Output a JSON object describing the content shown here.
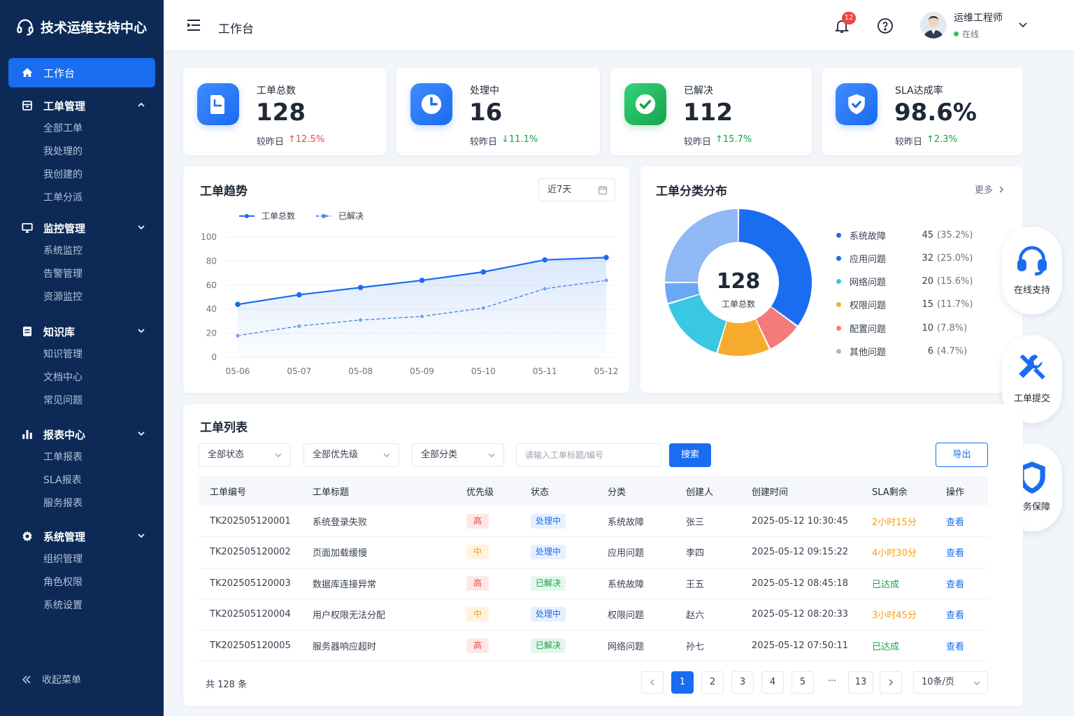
{
  "sidebar": {
    "brand": "技术运维支持中心",
    "home": "工作台",
    "groups": [
      {
        "label": "工单管理",
        "items": [
          "全部工单",
          "我处理的",
          "我创建的",
          "工单分派"
        ]
      },
      {
        "label": "监控管理",
        "items": [
          "系统监控",
          "告警管理",
          "资源监控"
        ]
      },
      {
        "label": "知识库",
        "items": [
          "知识管理",
          "文档中心",
          "常见问题"
        ]
      },
      {
        "label": "报表中心",
        "items": [
          "工单报表",
          "SLA报表",
          "服务报表"
        ]
      },
      {
        "label": "系统管理",
        "items": [
          "组织管理",
          "角色权限",
          "系统设置"
        ]
      }
    ],
    "collapse": "收起菜单"
  },
  "header": {
    "title": "工作台",
    "notifications": "12",
    "user_name": "运维工程师",
    "user_status": "在线"
  },
  "stats": [
    {
      "label": "工单总数",
      "value": "128",
      "compare": "较昨日",
      "change": "↑12.5%"
    },
    {
      "label": "处理中",
      "value": "16",
      "compare": "较昨日",
      "change": "↓11.1%"
    },
    {
      "label": "已解决",
      "value": "112",
      "compare": "较昨日",
      "change": "↑15.7%"
    },
    {
      "label": "SLA达成率",
      "value": "98.6%",
      "compare": "较昨日",
      "change": "↑2.3%"
    }
  ],
  "trend": {
    "title": "工单趋势",
    "range": "近7天"
  },
  "chart_data": [
    {
      "type": "line",
      "title": "工单趋势",
      "x": [
        "05-06",
        "05-07",
        "05-08",
        "05-09",
        "05-10",
        "05-11",
        "05-12"
      ],
      "yticks": [
        "100",
        "80",
        "60",
        "40",
        "20",
        "0"
      ],
      "ylim": [
        0,
        100
      ],
      "grid": true,
      "legend_position": "top-left",
      "series": [
        {
          "name": "工单总数",
          "values": [
            44,
            52,
            58,
            64,
            71,
            81,
            83
          ],
          "color": "#1a6cf0",
          "style": "solid"
        },
        {
          "name": "已解决",
          "values": [
            18,
            26,
            31,
            34,
            41,
            57,
            64
          ],
          "color": "#4a86e8",
          "style": "dashed"
        }
      ]
    },
    {
      "type": "pie",
      "title": "工单分类分布",
      "center_value": "128",
      "center_label": "工单总数",
      "slices": [
        {
          "name": "系统故障",
          "value": 45,
          "percent": "(35.2%)",
          "color": "#1a6cf0"
        },
        {
          "name": "应用问题",
          "value": 32,
          "percent": "(25.0%)",
          "color": "#2e6be6"
        },
        {
          "name": "网络问题",
          "value": 20,
          "percent": "(15.6%)",
          "color": "#2ec4e0"
        },
        {
          "name": "权限问题",
          "value": 15,
          "percent": "(11.7%)",
          "color": "#f5a623"
        },
        {
          "name": "配置问题",
          "value": 10,
          "percent": "(7.8%)",
          "color": "#f07a7a"
        },
        {
          "name": "其他问题",
          "value": 6,
          "percent": "(4.7%)",
          "color": "#9ca3af"
        }
      ]
    }
  ],
  "category": {
    "title": "工单分类分布",
    "more": "更多"
  },
  "fabs": [
    "在线支持",
    "工单提交",
    "服务保障"
  ],
  "tickets": {
    "title": "工单列表",
    "filters": [
      "全部状态",
      "全部优先级",
      "全部分类"
    ],
    "search_placeholder": "请输入工单标题/编号",
    "search_btn": "搜索",
    "export_btn": "导出",
    "columns": [
      "工单编号",
      "工单标题",
      "优先级",
      "状态",
      "分类",
      "创建人",
      "创建时间",
      "SLA剩余",
      "操作"
    ],
    "rows": [
      {
        "id": "TK202505120001",
        "title": "系统登录失败",
        "priority": "高",
        "pcls": "p-high",
        "status": "处理中",
        "scls": "s-proc",
        "category": "系统故障",
        "creator": "张三",
        "time": "2025-05-12 10:30:45",
        "sla": "2小时15分",
        "slacls": "sla-orange",
        "action": "查看"
      },
      {
        "id": "TK202505120002",
        "title": "页面加载缓慢",
        "priority": "中",
        "pcls": "p-mid",
        "status": "处理中",
        "scls": "s-proc",
        "category": "应用问题",
        "creator": "李四",
        "time": "2025-05-12 09:15:22",
        "sla": "4小时30分",
        "slacls": "sla-orange",
        "action": "查看"
      },
      {
        "id": "TK202505120003",
        "title": "数据库连接异常",
        "priority": "高",
        "pcls": "p-high",
        "status": "已解决",
        "scls": "s-done",
        "category": "系统故障",
        "creator": "王五",
        "time": "2025-05-12 08:45:18",
        "sla": "已达成",
        "slacls": "sla-green",
        "action": "查看"
      },
      {
        "id": "TK202505120004",
        "title": "用户权限无法分配",
        "priority": "中",
        "pcls": "p-mid",
        "status": "处理中",
        "scls": "s-proc",
        "category": "权限问题",
        "creator": "赵六",
        "time": "2025-05-12 08:20:33",
        "sla": "3小时45分",
        "slacls": "sla-orange",
        "action": "查看"
      },
      {
        "id": "TK202505120005",
        "title": "服务器响应超时",
        "priority": "高",
        "pcls": "p-high",
        "status": "已解决",
        "scls": "s-done",
        "category": "网络问题",
        "creator": "孙七",
        "time": "2025-05-12 07:50:11",
        "sla": "已达成",
        "slacls": "sla-green",
        "action": "查看"
      }
    ],
    "total": "共 128 条",
    "pages": [
      "1",
      "2",
      "3",
      "4",
      "5",
      "···",
      "13"
    ],
    "page_size": "10条/页"
  }
}
